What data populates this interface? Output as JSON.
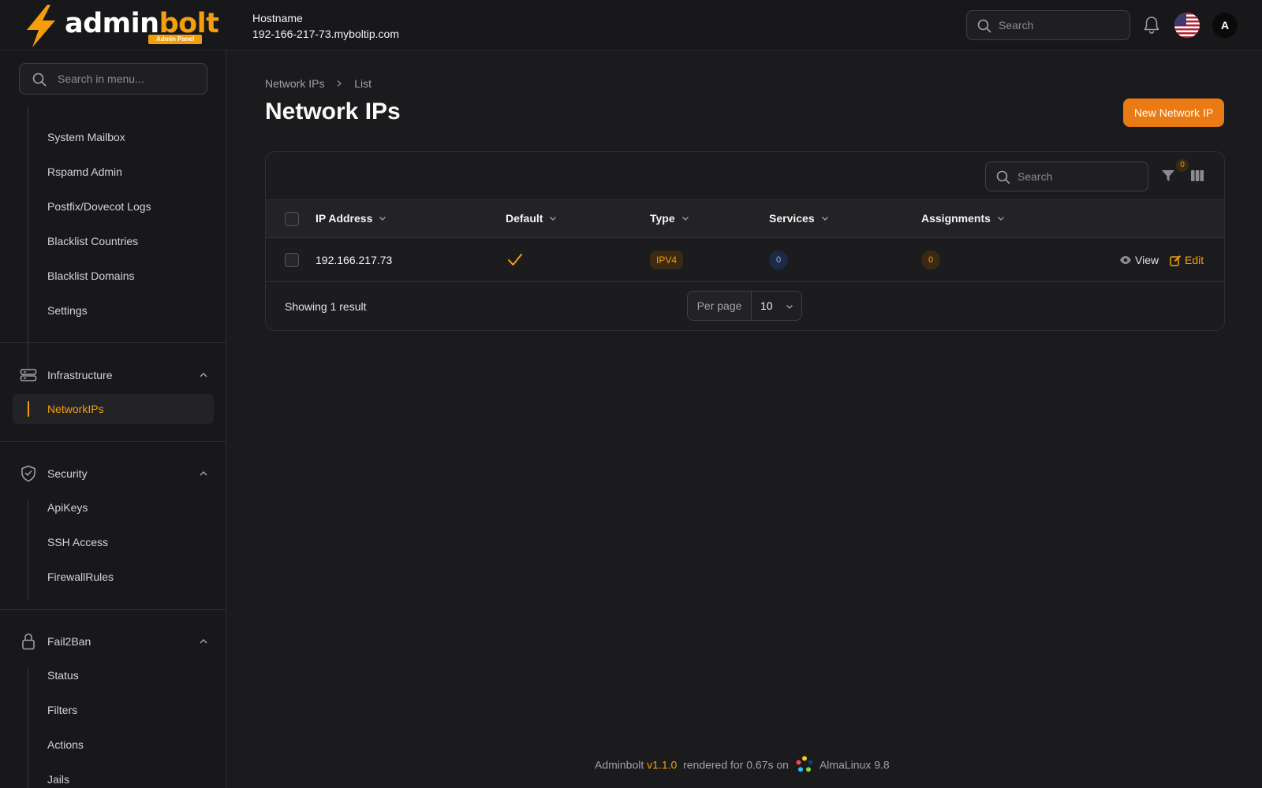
{
  "brand": {
    "logo_word_white": "admin",
    "logo_word_orange": "bolt",
    "logo_badge": "Admin Panel",
    "accent": "#f59e0b",
    "button_color": "#ea7a13"
  },
  "header": {
    "host_label": "Hostname",
    "host_value": "192-166-217-73.myboltip.com",
    "search_placeholder": "Search",
    "avatar_initial": "A",
    "icons": [
      "search-icon",
      "bell-icon",
      "us-flag-icon"
    ]
  },
  "sidebar": {
    "search_placeholder": "Search in menu...",
    "mail_items": [
      {
        "label": "System Mailbox"
      },
      {
        "label": "Rspamd Admin"
      },
      {
        "label": "Postfix/Dovecot Logs"
      },
      {
        "label": "Blacklist Countries"
      },
      {
        "label": "Blacklist Domains"
      },
      {
        "label": "Settings"
      }
    ],
    "infrastructure": {
      "label": "Infrastructure",
      "icon": "server-icon",
      "items": [
        {
          "label": "NetworkIPs",
          "active": true
        }
      ]
    },
    "security": {
      "label": "Security",
      "icon": "shield-check-icon",
      "items": [
        {
          "label": "ApiKeys"
        },
        {
          "label": "SSH Access"
        },
        {
          "label": "FirewallRules"
        }
      ]
    },
    "fail2ban": {
      "label": "Fail2Ban",
      "icon": "lock-icon",
      "items": [
        {
          "label": "Status"
        },
        {
          "label": "Filters"
        },
        {
          "label": "Actions"
        },
        {
          "label": "Jails"
        }
      ]
    }
  },
  "page": {
    "breadcrumb": [
      "Network IPs",
      "List"
    ],
    "title": "Network IPs",
    "new_button": "New Network IP"
  },
  "table": {
    "search_placeholder": "Search",
    "filter_count": "0",
    "columns": [
      "IP Address",
      "Default",
      "Type",
      "Services",
      "Assignments"
    ],
    "rows": [
      {
        "ip": "192.166.217.73",
        "default": true,
        "type": "IPV4",
        "services": "0",
        "assignments": "0",
        "view_label": "View",
        "edit_label": "Edit"
      }
    ],
    "showing": "Showing 1 result",
    "per_page_label": "Per page",
    "per_page_value": "10"
  },
  "footer": {
    "name": "Adminbolt",
    "version": "v1.1.0",
    "rendered": "rendered for 0.67s on",
    "os": "AlmaLinux 9.8"
  }
}
